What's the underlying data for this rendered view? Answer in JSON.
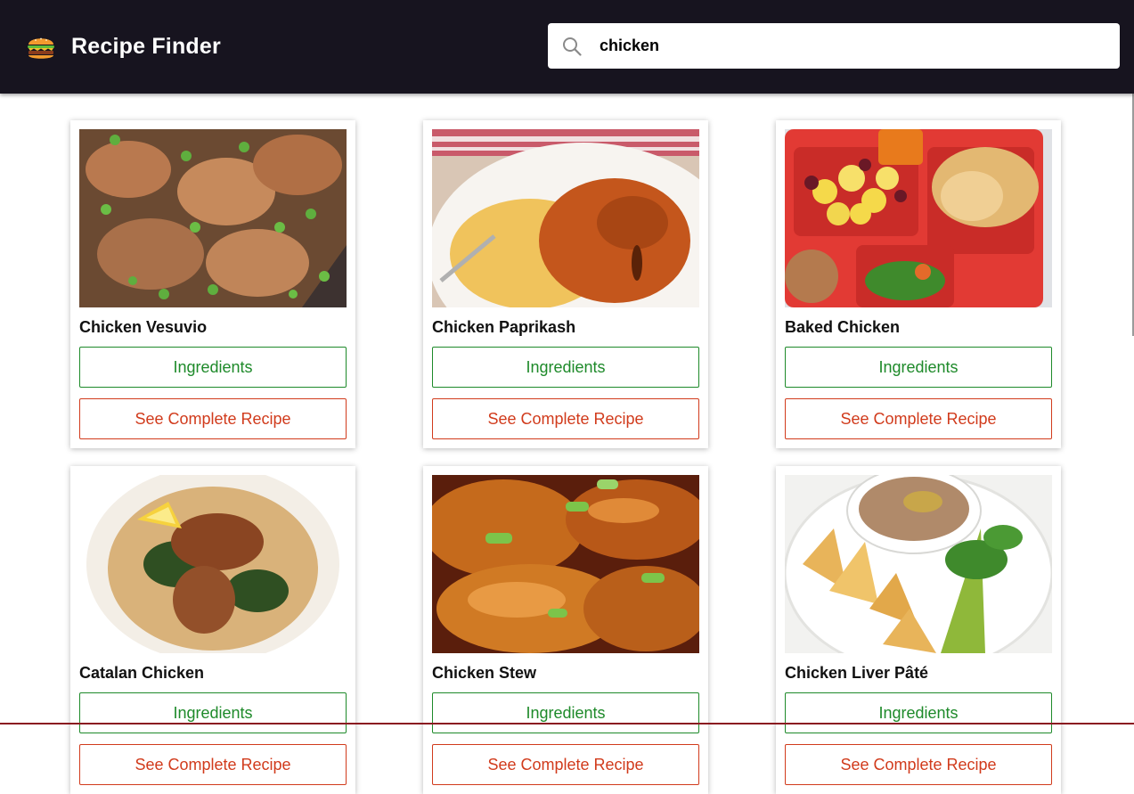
{
  "header": {
    "app_title": "Recipe Finder",
    "logo_icon": "burger-icon"
  },
  "search": {
    "icon": "search-icon",
    "value": "chicken",
    "placeholder": ""
  },
  "recipes": [
    {
      "title": "Chicken Vesuvio",
      "ingredients_label": "Ingredients",
      "recipe_label": "See Complete Recipe"
    },
    {
      "title": "Chicken Paprikash",
      "ingredients_label": "Ingredients",
      "recipe_label": "See Complete Recipe"
    },
    {
      "title": "Baked Chicken",
      "ingredients_label": "Ingredients",
      "recipe_label": "See Complete Recipe"
    },
    {
      "title": "Catalan Chicken",
      "ingredients_label": "Ingredients",
      "recipe_label": "See Complete Recipe"
    },
    {
      "title": "Chicken Stew",
      "ingredients_label": "Ingredients",
      "recipe_label": "See Complete Recipe"
    },
    {
      "title": "Chicken Liver Pâté",
      "ingredients_label": "Ingredients",
      "recipe_label": "See Complete Recipe"
    }
  ],
  "colors": {
    "header_bg": "#17141f",
    "ingredients_accent": "#1e8a2a",
    "recipe_accent": "#d13b1c"
  }
}
